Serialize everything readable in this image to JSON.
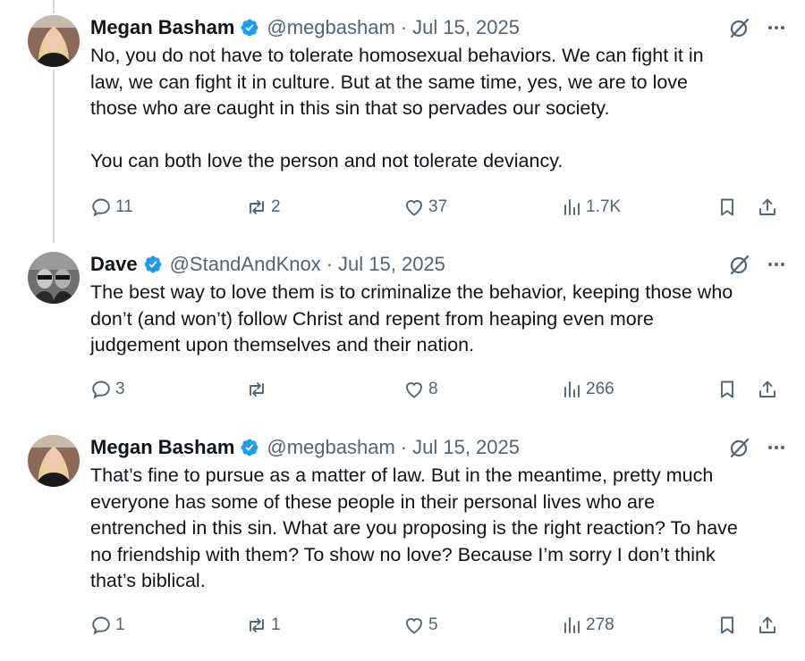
{
  "tweets": [
    {
      "name": "Megan Basham",
      "handle": "@megbasham",
      "date": "Jul 15, 2025",
      "text": "No, you do not have to tolerate homosexual behaviors. We can fight it in\nlaw, we can fight it in culture. But at the same time, yes, we are to love\nthose who are caught in this sin that so pervades our society.\n\nYou can both love the person and not tolerate deviancy.",
      "replies": "11",
      "reposts": "2",
      "likes": "37",
      "views": "1.7K"
    },
    {
      "name": "Dave",
      "handle": "@StandAndKnox",
      "date": "Jul 15, 2025",
      "text": "The best way to love them is to criminalize the behavior, keeping those who\ndon’t (and won’t) follow Christ and repent from heaping even more\njudgement upon themselves and their nation.",
      "replies": "3",
      "reposts": "",
      "likes": "8",
      "views": "266"
    },
    {
      "name": "Megan Basham",
      "handle": "@megbasham",
      "date": "Jul 15, 2025",
      "text": "That’s fine to pursue as a matter of law. But in the meantime, pretty much\neveryone has some of these people in their personal lives who are\nentrenched in this sin. What are you proposing is the right reaction? To have\nno friendship with them? To show no love? Because I’m sorry I don’t think\nthat’s biblical.",
      "replies": "1",
      "reposts": "1",
      "likes": "5",
      "views": "278"
    }
  ],
  "separator": "·",
  "colors": {
    "verified": "#1d9bf0",
    "muted": "#536471",
    "thread_line": "#cfd9de",
    "text": "#0f1419"
  },
  "icons": [
    "verified-badge-icon",
    "grok-icon",
    "more-icon",
    "reply-icon",
    "repost-icon",
    "like-icon",
    "views-icon",
    "bookmark-icon",
    "share-icon"
  ]
}
